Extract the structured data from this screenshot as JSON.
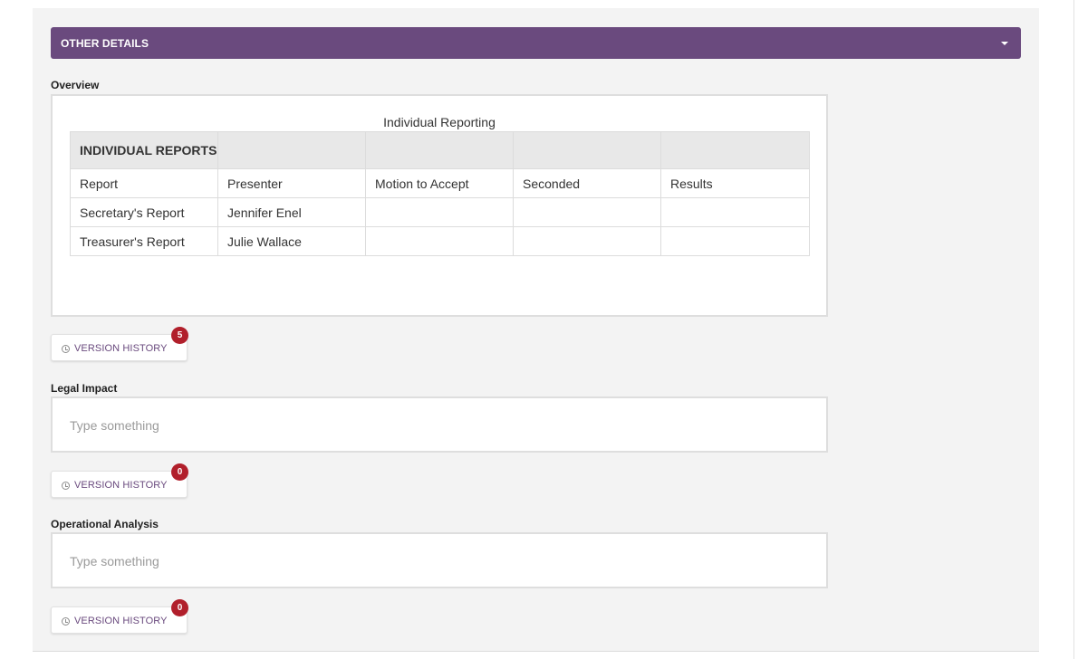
{
  "section": {
    "title": "OTHER DETAILS",
    "caret_icon": "caret-down-icon"
  },
  "overview": {
    "label": "Overview",
    "table_caption": "Individual Reporting",
    "table": {
      "header": [
        "INDIVIDUAL REPORTS",
        "",
        "",
        "",
        ""
      ],
      "columns": [
        "Report",
        "Presenter",
        "Motion to Accept",
        "Seconded",
        "Results"
      ],
      "rows": [
        [
          "Secretary's Report",
          "Jennifer Enel",
          "",
          "",
          ""
        ],
        [
          "Treasurer's Report",
          "Julie Wallace",
          "",
          "",
          ""
        ]
      ]
    },
    "version_history": {
      "label": "VERSION HISTORY",
      "count": "5",
      "icon": "clock-icon"
    }
  },
  "legal_impact": {
    "label": "Legal Impact",
    "placeholder": "Type something",
    "version_history": {
      "label": "VERSION HISTORY",
      "count": "0",
      "icon": "clock-icon"
    }
  },
  "operational_analysis": {
    "label": "Operational Analysis",
    "placeholder": "Type something",
    "version_history": {
      "label": "VERSION HISTORY",
      "count": "0",
      "icon": "clock-icon"
    }
  },
  "colors": {
    "header_bg": "#6a4a7e",
    "badge_bg": "#b11f2b",
    "panel_bg": "#f3f3f3"
  }
}
